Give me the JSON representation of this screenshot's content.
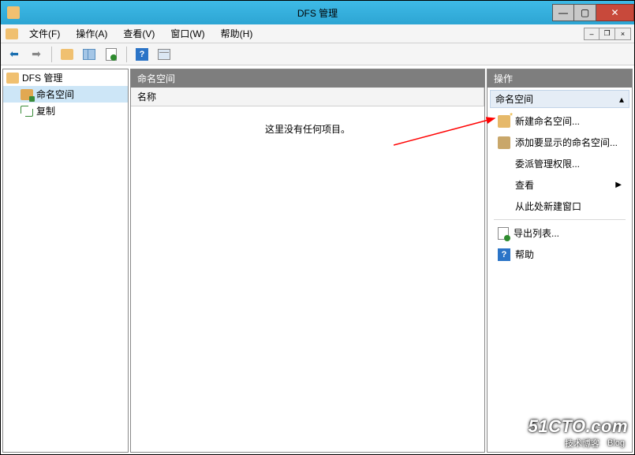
{
  "window": {
    "title": "DFS 管理"
  },
  "menubar": {
    "items": [
      {
        "label": "文件(F)"
      },
      {
        "label": "操作(A)"
      },
      {
        "label": "查看(V)"
      },
      {
        "label": "窗口(W)"
      },
      {
        "label": "帮助(H)"
      }
    ]
  },
  "tree": {
    "root": "DFS 管理",
    "children": [
      {
        "label": "命名空间"
      },
      {
        "label": "复制"
      }
    ]
  },
  "content": {
    "header": "命名空间",
    "column_name": "名称",
    "empty_text": "这里没有任何项目。"
  },
  "actions": {
    "title": "操作",
    "section": "命名空间",
    "items": [
      {
        "label": "新建命名空间...",
        "icon": "new-namespace-icon"
      },
      {
        "label": "添加要显示的命名空间...",
        "icon": "add-namespace-icon"
      },
      {
        "label": "委派管理权限...",
        "icon": ""
      },
      {
        "label": "查看",
        "icon": "",
        "has_submenu": true
      },
      {
        "label": "从此处新建窗口",
        "icon": ""
      }
    ],
    "secondary": [
      {
        "label": "导出列表...",
        "icon": "export-icon"
      },
      {
        "label": "帮助",
        "icon": "help-icon"
      }
    ]
  },
  "watermark": {
    "line1": "51CTO.com",
    "line2": "技术博客",
    "badge": "Blog"
  }
}
